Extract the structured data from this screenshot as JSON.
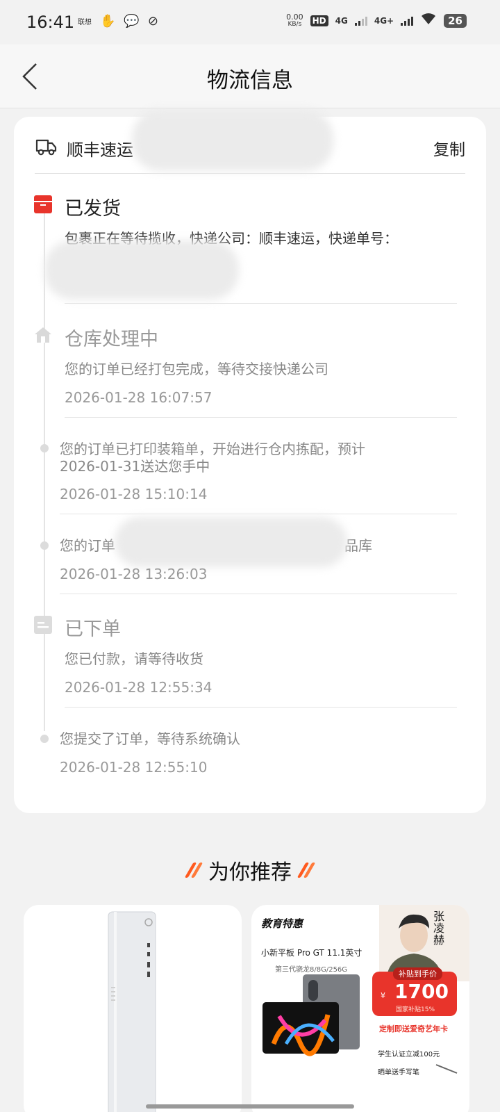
{
  "status_bar": {
    "time": "16:41",
    "left_badge": "联想",
    "speed_value": "0.00",
    "speed_unit": "KB/s",
    "hd_label": "HD",
    "net1": "4G",
    "net2": "4G+",
    "battery": "26"
  },
  "header": {
    "title": "物流信息"
  },
  "carrier": {
    "name": "顺丰速运",
    "copy_label": "复制"
  },
  "timeline": [
    {
      "kind": "milestone",
      "title": "已发货",
      "text": "包裹正在等待揽收，快递公司：顺丰速运，快递单号："
    },
    {
      "kind": "milestone",
      "title": "仓库处理中",
      "text": "您的订单已经打包完成，等待交接快递公司",
      "time": "2026-01-28 16:07:57"
    },
    {
      "kind": "event",
      "text": "您的订单已打印装箱单，开始进行仓内拣配，预计2026-01-31送达您手中",
      "time": "2026-01-28 15:10:14"
    },
    {
      "kind": "event",
      "text_start": "您的订单",
      "text_end": "品库",
      "time": "2026-01-28 13:26:03"
    },
    {
      "kind": "milestone",
      "title": "已下单",
      "text": "您已付款，请等待收货",
      "time": "2026-01-28 12:55:34"
    },
    {
      "kind": "event",
      "text": "您提交了订单，等待系统确认",
      "time": "2026-01-28 12:55:10"
    }
  ],
  "recommend": {
    "title": "为你推荐",
    "product_b": {
      "promo_tag": "教育特惠",
      "model": "小新平板 Pro GT 11.1英寸",
      "spec": "第三代骁龙8/8G/256G",
      "person_name": "张凌赫",
      "subsidy_label": "补贴到手价",
      "currency": "¥",
      "price": "1700",
      "subsidy_note": "国家补贴15%",
      "gift": "定制即送爱奇艺年卡",
      "student": "学生认证立减100元",
      "bonus": "晒单送手写笔"
    }
  },
  "colors": {
    "accent": "#e8342b",
    "brand_orange": "#ff5a1f"
  }
}
